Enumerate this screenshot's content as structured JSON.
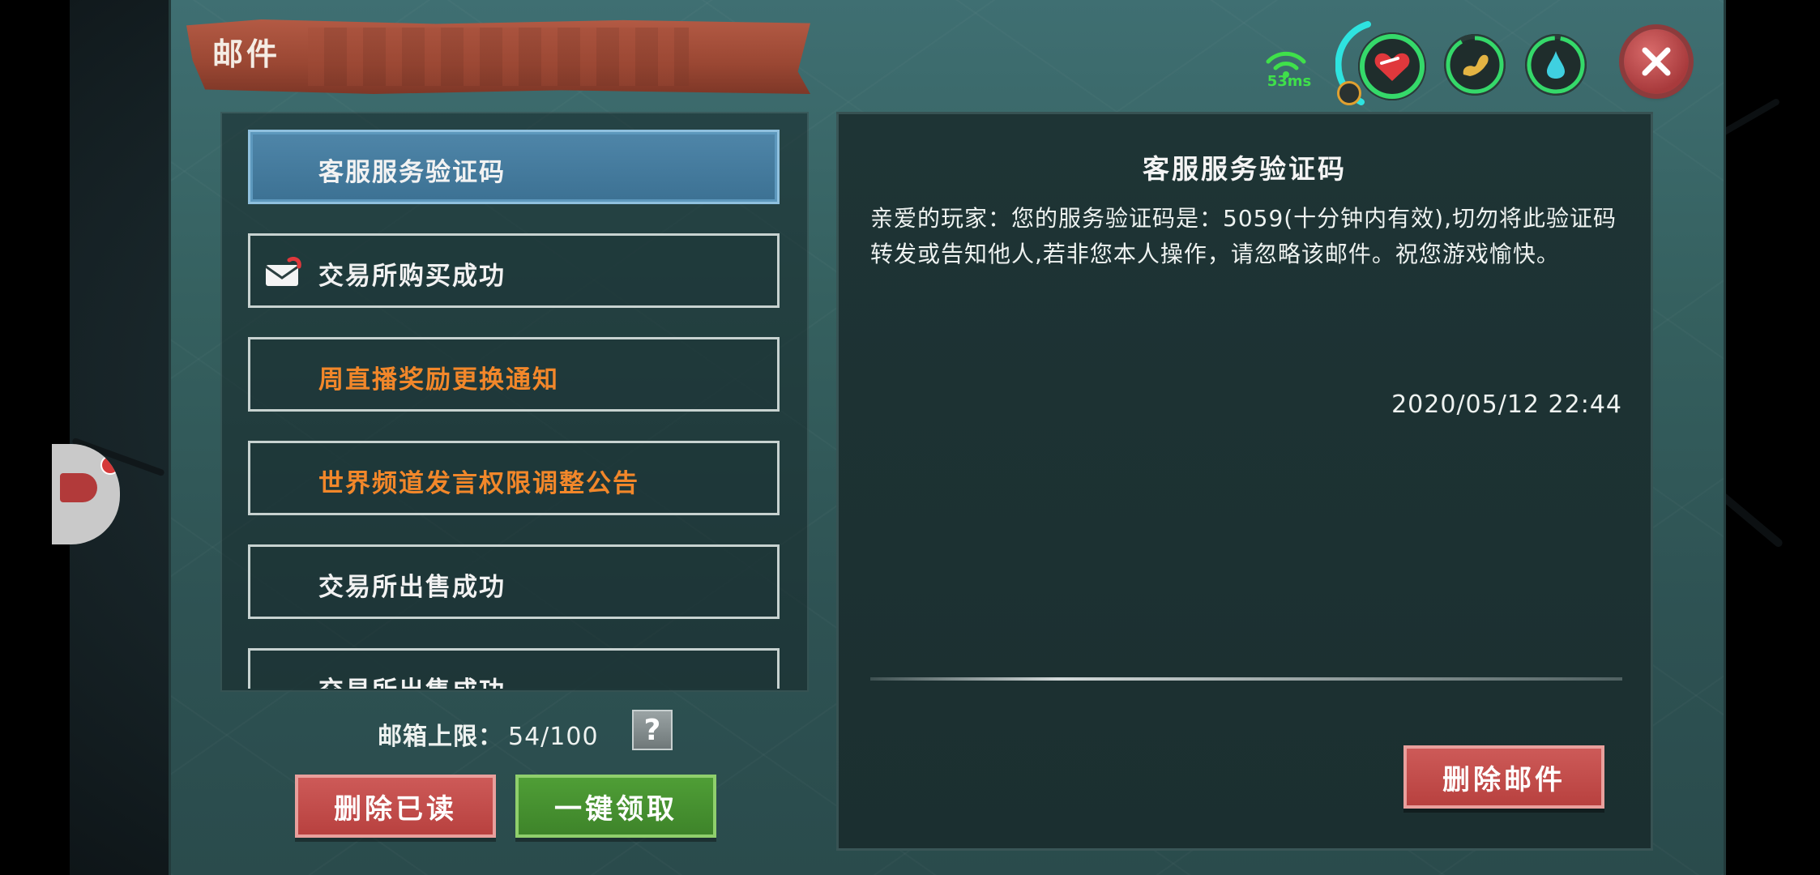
{
  "window": {
    "title": "邮件",
    "ping": "53ms"
  },
  "mail_list": [
    {
      "title": "客服服务验证码",
      "selected": true,
      "color": "#f2f2f2",
      "icon": null
    },
    {
      "title": "交易所购买成功",
      "selected": false,
      "color": "#f2f2f2",
      "icon": "mail-envelope-icon"
    },
    {
      "title": "周直播奖励更换通知",
      "selected": false,
      "color": "#f2872a",
      "icon": null
    },
    {
      "title": "世界频道发言权限调整公告",
      "selected": false,
      "color": "#f2872a",
      "icon": null
    },
    {
      "title": "交易所出售成功",
      "selected": false,
      "color": "#f2f2f2",
      "icon": null
    },
    {
      "title": "交易所出售成功",
      "selected": false,
      "color": "#f2f2f2",
      "icon": null
    }
  ],
  "mailbox": {
    "capacity_label": "邮箱上限：",
    "capacity_value": "54/100",
    "help_label": "?"
  },
  "buttons": {
    "delete_read": "删除已读",
    "claim_all": "一键领取",
    "delete_mail": "删除邮件"
  },
  "detail": {
    "title": "客服服务验证码",
    "body": "亲爱的玩家：您的服务验证码是：5059(十分钟内有效),切勿将此验证码转发或告知他人,若非您本人操作，请忽略该邮件。祝您游戏愉快。",
    "timestamp": "2020/05/12 22:44"
  },
  "status_icons": [
    "health-heart-icon",
    "stomach-food-icon",
    "water-drop-icon",
    "wifi-signal-icon"
  ],
  "colors": {
    "accent_orange": "#f2872a",
    "selected_blue": "#4f86a9",
    "button_red": "#c04b49",
    "button_green": "#47932f",
    "ping_green": "#3fe04a"
  }
}
